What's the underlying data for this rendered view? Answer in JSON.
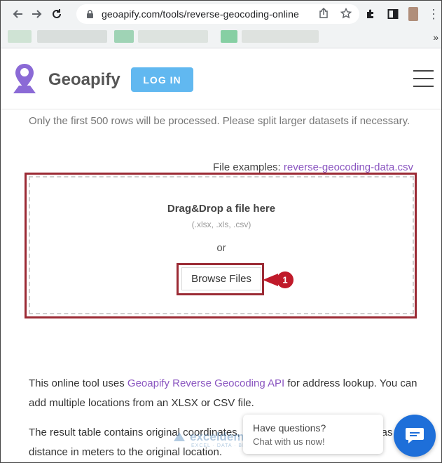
{
  "browser": {
    "url": "geoapify.com/tools/reverse-geocoding-online",
    "icons": [
      "back-arrow-icon",
      "forward-arrow-icon",
      "reload-icon",
      "lock-icon",
      "share-icon",
      "star-icon",
      "extensions-icon",
      "sidepanel-icon",
      "kebab-icon"
    ]
  },
  "site": {
    "brand": "Geoapify",
    "login_label": "LOG IN",
    "login_color": "#61b8f0",
    "accent_link_color": "#8a55c0"
  },
  "page": {
    "note": "Only the first 500 rows will be processed. Please split larger datasets if necessary.",
    "examples_label": "File examples:",
    "examples_link": "reverse-geocoding-data.csv",
    "dropzone": {
      "title": "Drag&Drop a file here",
      "formats": "(.xlsx, .xls, .csv)",
      "or": "or",
      "browse_label": "Browse Files"
    },
    "step_marker": "1",
    "desc1_before": "This online tool uses ",
    "desc1_link": "Geoapify Reverse Geocoding API",
    "desc1_after": " for address lookup. You can add multiple locations from an XLSX or CSV file.",
    "desc2": "The result table contains original coordinates, address components, as well as distance in meters to the original location."
  },
  "watermark": {
    "name": "exceldemy",
    "sub": "EXCEL · DATA · BI"
  },
  "chat": {
    "question": "Have questions?",
    "sub": "Chat with us now!"
  }
}
